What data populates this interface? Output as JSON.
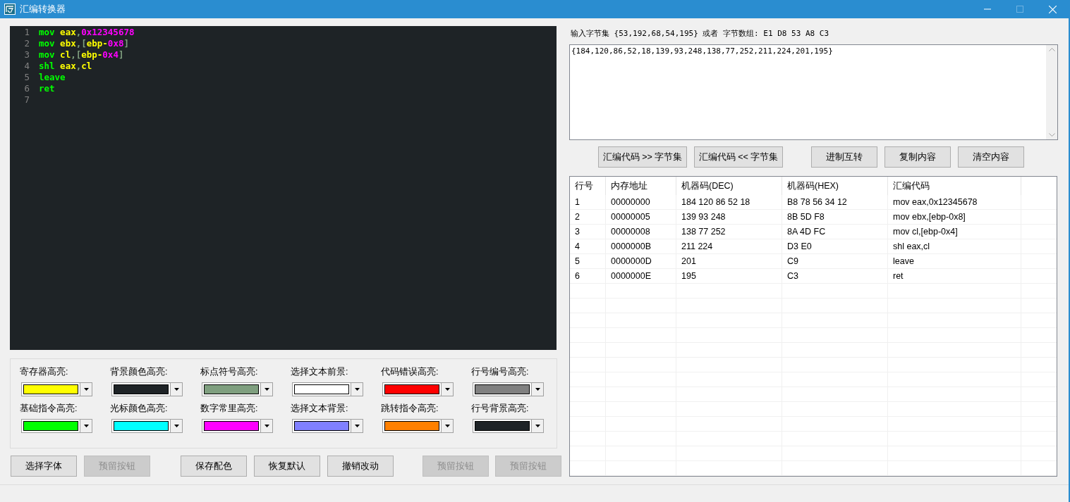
{
  "window": {
    "title": "汇编转换器"
  },
  "editor": {
    "lines": [
      {
        "number": "1",
        "tokens": [
          {
            "text": "mov",
            "kind": "instruction"
          },
          {
            "text": " eax",
            "kind": "register"
          },
          {
            "text": ",",
            "kind": "punct"
          },
          {
            "text": "0x12345678",
            "kind": "number"
          }
        ]
      },
      {
        "number": "2",
        "tokens": [
          {
            "text": "mov",
            "kind": "instruction"
          },
          {
            "text": " ebx",
            "kind": "register"
          },
          {
            "text": ",[",
            "kind": "punct"
          },
          {
            "text": "ebp-",
            "kind": "register"
          },
          {
            "text": "0x8",
            "kind": "number"
          },
          {
            "text": "]",
            "kind": "punct"
          }
        ]
      },
      {
        "number": "3",
        "tokens": [
          {
            "text": "mov",
            "kind": "instruction"
          },
          {
            "text": " cl",
            "kind": "register"
          },
          {
            "text": ",[",
            "kind": "punct"
          },
          {
            "text": "ebp-",
            "kind": "register"
          },
          {
            "text": "0x4",
            "kind": "number"
          },
          {
            "text": "]",
            "kind": "punct"
          }
        ]
      },
      {
        "number": "4",
        "tokens": [
          {
            "text": "shl",
            "kind": "instruction"
          },
          {
            "text": " eax",
            "kind": "register"
          },
          {
            "text": ",",
            "kind": "punct"
          },
          {
            "text": "cl",
            "kind": "register"
          }
        ]
      },
      {
        "number": "5",
        "tokens": [
          {
            "text": "leave",
            "kind": "instruction"
          }
        ]
      },
      {
        "number": "6",
        "tokens": [
          {
            "text": "ret",
            "kind": "instruction"
          }
        ]
      },
      {
        "number": "7"
      }
    ]
  },
  "color_settings": [
    {
      "label": "寄存器高亮:",
      "color": "#ffff00"
    },
    {
      "label": "背景颜色高亮:",
      "color": "#1e2326"
    },
    {
      "label": "标点符号高亮:",
      "color": "#7f9f7f"
    },
    {
      "label": "选择文本前景:",
      "color": "#ffffff"
    },
    {
      "label": "代码错误高亮:",
      "color": "#ff0000"
    },
    {
      "label": "行号编号高亮:",
      "color": "#808080"
    },
    {
      "label": "基础指令高亮:",
      "color": "#00ff00"
    },
    {
      "label": "光标颜色高亮:",
      "color": "#00ffff"
    },
    {
      "label": "数字常里高亮:",
      "color": "#ff00ff"
    },
    {
      "label": "选择文本背景:",
      "color": "#8080ff"
    },
    {
      "label": "跳转指令高亮:",
      "color": "#ff8000"
    },
    {
      "label": "行号背景高亮:",
      "color": "#1e2326"
    }
  ],
  "bottom_buttons": [
    {
      "label": "选择字体",
      "disabled": false
    },
    {
      "label": "预留按钮",
      "disabled": true
    },
    {
      "label": "保存配色",
      "disabled": false
    },
    {
      "label": "恢复默认",
      "disabled": false
    },
    {
      "label": "撤销改动",
      "disabled": false
    },
    {
      "label": "预留按钮",
      "disabled": true
    },
    {
      "label": "预留按钮",
      "disabled": true
    }
  ],
  "byte_input": {
    "hint": "输入字节集 {53,192,68,54,195} 或者 字节数组: E1 D8 53 A8 C3",
    "value": "{184,120,86,52,18,139,93,248,138,77,252,211,224,201,195}"
  },
  "action_buttons": [
    "汇编代码 >> 字节集",
    "汇编代码 << 字节集",
    "进制互转",
    "复制内容",
    "清空内容"
  ],
  "table": {
    "columns": [
      "行号",
      "内存地址",
      "机器码(DEC)",
      "机器码(HEX)",
      "汇编代码"
    ],
    "rows": [
      [
        "1",
        "00000000",
        "184 120 86 52 18",
        "B8 78 56 34 12",
        "mov eax,0x12345678"
      ],
      [
        "2",
        "00000005",
        "139 93 248",
        "8B 5D F8",
        "mov ebx,[ebp-0x8]"
      ],
      [
        "3",
        "00000008",
        "138 77 252",
        "8A 4D FC",
        "mov cl,[ebp-0x4]"
      ],
      [
        "4",
        "0000000B",
        "211 224",
        "D3 E0",
        "shl eax,cl"
      ],
      [
        "5",
        "0000000D",
        "201",
        "C9",
        "leave"
      ],
      [
        "6",
        "0000000E",
        "195",
        "C3",
        "ret"
      ]
    ]
  }
}
